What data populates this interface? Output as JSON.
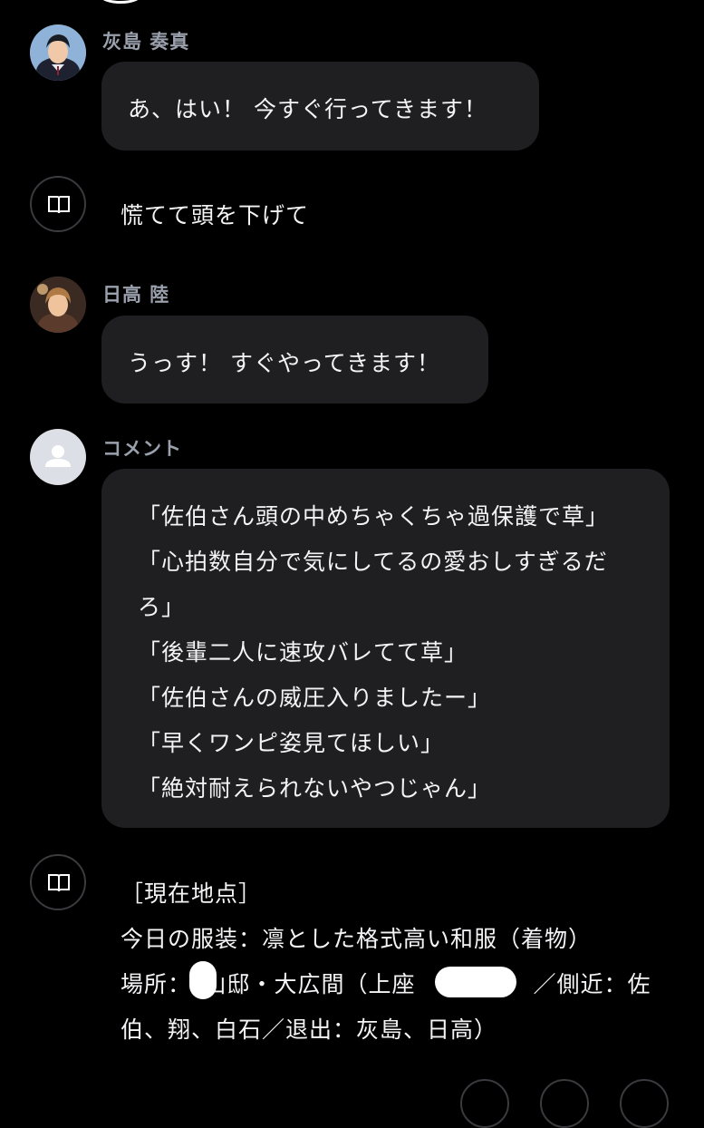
{
  "messages": [
    {
      "speaker": "灰島 奏真",
      "text": "あ、はい！ 今すぐ行ってきます！"
    },
    {
      "narration": "慌てて頭を下げて"
    },
    {
      "speaker": "日高 陸",
      "text": "うっす！ すぐやってきます！"
    },
    {
      "speaker": "コメント",
      "lines": [
        "「佐伯さん頭の中めちゃくちゃ過保護で草」",
        "「心拍数自分で気にしてるの愛おしすぎるだ",
        "ろ」",
        "「後輩二人に速攻バレてて草」",
        "「佐伯さんの威圧入りましたー」",
        "「早くワンピ姿見てほしい」",
        "「絶対耐えられないやつじゃん」"
      ]
    },
    {
      "narration_lines": [
        "［現在地点］",
        "今日の服装：凛とした格式高い和服（着物）",
        "場所：　山邸・大広間（上座　　　　　／側近：佐",
        "伯、翔、白石／退出：灰島、日高）"
      ]
    }
  ],
  "icons": {
    "narration": "open-book-icon",
    "comment_avatar": "default-user-icon"
  },
  "colors": {
    "background": "#000000",
    "bubble": "#1f1f22",
    "name": "#9aa0ac",
    "text": "#f4f4f6"
  }
}
